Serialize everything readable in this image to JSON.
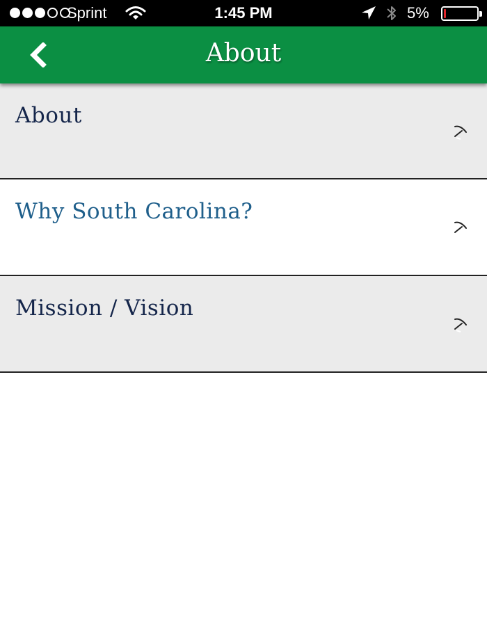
{
  "status_bar": {
    "carrier": "Sprint",
    "signal_bars_filled": 3,
    "signal_bars_total": 5,
    "time": "1:45 PM",
    "battery_text": "5%",
    "battery_level": 0.05,
    "icons": [
      "wifi-icon",
      "location-arrow-icon",
      "bluetooth-icon",
      "battery-icon"
    ]
  },
  "nav": {
    "title": "About",
    "back_icon": "chevron-left-icon"
  },
  "list": {
    "items": [
      {
        "label": "About",
        "icon": "chevron-right-icon"
      },
      {
        "label": "Why South Carolina?",
        "icon": "chevron-right-icon"
      },
      {
        "label": "Mission / Vision",
        "icon": "chevron-right-icon"
      }
    ]
  },
  "colors": {
    "nav_green": "#0b8f43",
    "item_text_navy": "#14254a",
    "item_text_blue": "#1f5f8b",
    "row_grey": "#ebebeb",
    "battery_red": "#e0262b"
  }
}
